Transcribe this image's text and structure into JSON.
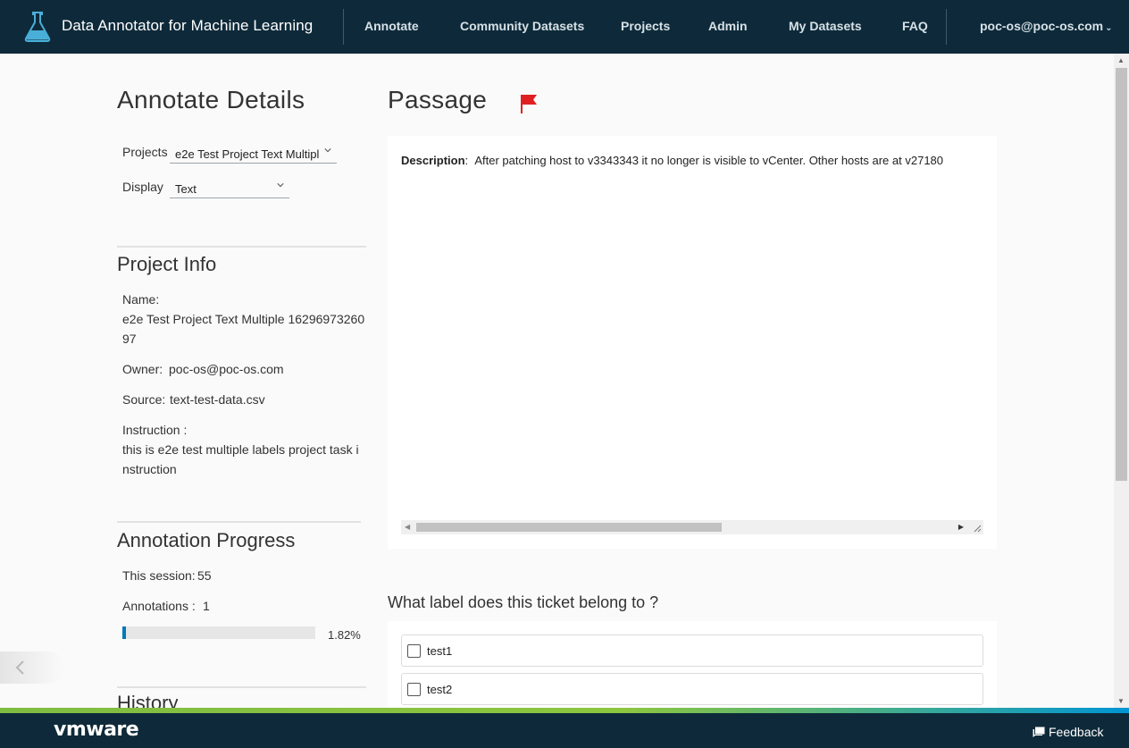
{
  "header": {
    "title": "Data Annotator for Machine Learning",
    "nav": [
      "Annotate",
      "Community Datasets",
      "Projects",
      "Admin",
      "My Datasets",
      "FAQ"
    ],
    "user": "poc-os@poc-os.com"
  },
  "left": {
    "heading": "Annotate Details",
    "projects_label": "Projects",
    "projects_value": "e2e Test Project Text Multipl",
    "display_label": "Display",
    "display_value": "Text",
    "project_info": {
      "heading": "Project Info",
      "name_label": "Name:",
      "name_line1": "e2e Test Project Text Multiple 16296973260",
      "name_line2": "97",
      "owner_label": "Owner:",
      "owner_value": "poc-os@poc-os.com",
      "source_label": "Source:",
      "source_value": "text-test-data.csv",
      "instruction_label": "Instruction :",
      "instruction_line1": "this is e2e test multiple labels project task i",
      "instruction_line2": "nstruction"
    },
    "progress": {
      "heading": "Annotation Progress",
      "session_label": "This session:",
      "session_value": "55",
      "annotations_label": "Annotations :",
      "annotations_value": "1",
      "percent_text": "1.82%",
      "fraction": 0.0182
    },
    "history_heading": "History"
  },
  "passage": {
    "heading": "Passage",
    "description_label": "Description",
    "description_text": "After patching host to v3343343 it no longer is visible to vCenter.  Other hosts are at v27180"
  },
  "question": {
    "text": "What label does this ticket belong to ?",
    "options": [
      "test1",
      "test2"
    ]
  },
  "footer": {
    "brand": "vmware",
    "feedback": "Feedback"
  },
  "colors": {
    "header_bg": "#0e2a3a",
    "accent": "#0079b8",
    "flag": "#e02020"
  }
}
